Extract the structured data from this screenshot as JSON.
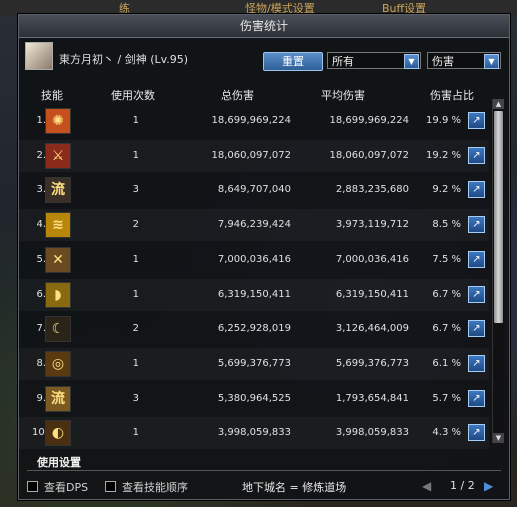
{
  "background": {
    "top_left_label": "练",
    "top_mid_label": "怪物/模式设置",
    "top_right_label": "Buff设置"
  },
  "window": {
    "title": "伤害统计"
  },
  "character": {
    "name": "東方月初丶 / 剑神 (Lv.95)"
  },
  "toolbar": {
    "reset_label": "重置",
    "filter_select": "所有",
    "metric_select": "伤害"
  },
  "table": {
    "headers": {
      "skill": "技能",
      "count": "使用次数",
      "total": "总伤害",
      "avg": "平均伤害",
      "share": "伤害占比"
    },
    "rows": [
      {
        "num": "1.",
        "count": "1",
        "total": "18,699,969,224",
        "avg": "18,699,969,224",
        "pct": "19.9 %",
        "icon_color": "#c4501e",
        "icon": "slash-burst-icon",
        "glyph": "✺"
      },
      {
        "num": "2.",
        "count": "1",
        "total": "18,060,097,072",
        "avg": "18,060,097,072",
        "pct": "19.2 %",
        "icon_color": "#8a2a1a",
        "icon": "sword-storm-icon",
        "glyph": "⚔"
      },
      {
        "num": "3.",
        "count": "3",
        "total": "8,649,707,040",
        "avg": "2,883,235,680",
        "pct": "9.2 %",
        "icon_color": "#3a3028",
        "icon": "flow-sword-icon",
        "glyph": "流"
      },
      {
        "num": "4.",
        "count": "2",
        "total": "7,946,239,424",
        "avg": "3,973,119,712",
        "pct": "8.5 %",
        "icon_color": "#b8860b",
        "icon": "triple-slash-icon",
        "glyph": "≋"
      },
      {
        "num": "5.",
        "count": "1",
        "total": "7,000,036,416",
        "avg": "7,000,036,416",
        "pct": "7.5 %",
        "icon_color": "#6a4a20",
        "icon": "cross-slash-icon",
        "glyph": "✕"
      },
      {
        "num": "6.",
        "count": "1",
        "total": "6,319,150,411",
        "avg": "6,319,150,411",
        "pct": "6.7 %",
        "icon_color": "#8a6a10",
        "icon": "wave-slash-icon",
        "glyph": "◗"
      },
      {
        "num": "7.",
        "count": "2",
        "total": "6,252,928,019",
        "avg": "3,126,464,009",
        "pct": "6.7 %",
        "icon_color": "#2a2418",
        "icon": "crescent-icon",
        "glyph": "☾"
      },
      {
        "num": "8.",
        "count": "1",
        "total": "5,699,376,773",
        "avg": "5,699,376,773",
        "pct": "6.1 %",
        "icon_color": "#5a3a10",
        "icon": "spin-slash-icon",
        "glyph": "◎"
      },
      {
        "num": "9.",
        "count": "3",
        "total": "5,380,964,525",
        "avg": "1,793,654,841",
        "pct": "5.7 %",
        "icon_color": "#7a5a20",
        "icon": "flow-wave-icon",
        "glyph": "流"
      },
      {
        "num": "10.",
        "count": "1",
        "total": "3,998,059,833",
        "avg": "3,998,059,833",
        "pct": "4.3 %",
        "icon_color": "#4a3010",
        "icon": "arc-slash-icon",
        "glyph": "◐"
      }
    ]
  },
  "footer": {
    "settings_label": "使用设置",
    "view_dps_label": "查看DPS",
    "view_order_label": "查看技能顺序",
    "dungeon_label": "地下城名 = 修炼道场",
    "page_text": "1 / 2"
  }
}
